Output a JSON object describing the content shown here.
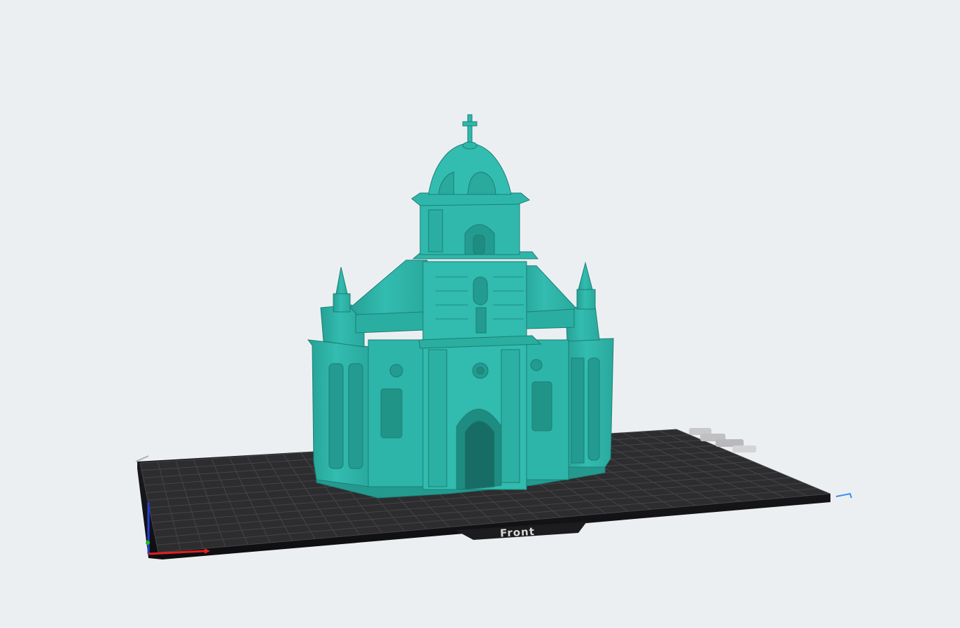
{
  "viewport": {
    "background": "#eceff1",
    "build_plate": {
      "front_label": "Front",
      "plate_color": "#2b2b2d",
      "grid_color": "#4a4a4c"
    },
    "model": {
      "color": "#2fb3a7",
      "shade_color": "#1f8c82",
      "highlight_color": "#5ad1c5"
    },
    "axes": {
      "x_color": "#e02020",
      "y_color": "#20c020",
      "z_color": "#2040e0"
    },
    "plate_toolbar": {
      "icons": [
        "grid-icon",
        "layers-icon",
        "rotate-icon",
        "hide-icon"
      ]
    },
    "corner_marker_color": "#3d8cf0"
  }
}
